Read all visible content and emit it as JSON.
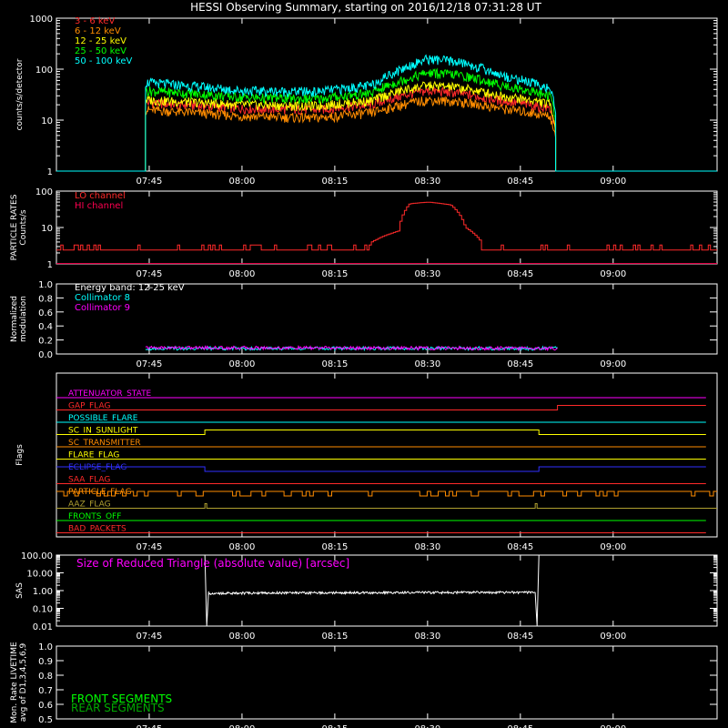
{
  "title": "HESSI Observing Summary, starting on 2016/12/18 07:31:28 UT",
  "time_ticks": [
    "07:45",
    "08:00",
    "08:15",
    "08:30",
    "08:45",
    "09:00"
  ],
  "colors": {
    "axes": "#ffffff",
    "red": "#ff2a2a",
    "orange": "#ff8c00",
    "yellow": "#ffff00",
    "green": "#00ff00",
    "cyan": "#00ffff",
    "magenta": "#ff00ff",
    "blue": "#3030ff",
    "olive": "#b0a030"
  },
  "chart_data": [
    {
      "id": "counts",
      "type": "line",
      "ylabel": "counts/s/detector",
      "yscale": "log",
      "ylim": [
        1,
        1000
      ],
      "y_ticks": [
        "1",
        "10",
        "100",
        "1000"
      ],
      "x_unit": "UT",
      "series": [
        {
          "name": "3 - 6 keV",
          "color": "#ff2a2a",
          "points": [
            [
              7.5,
              1
            ],
            [
              7.73,
              1
            ],
            [
              7.74,
              22
            ],
            [
              8.0,
              17
            ],
            [
              8.2,
              16
            ],
            [
              8.35,
              20
            ],
            [
              8.43,
              30
            ],
            [
              8.5,
              38
            ],
            [
              8.58,
              34
            ],
            [
              8.7,
              24
            ],
            [
              8.83,
              17
            ],
            [
              8.85,
              1
            ],
            [
              9.25,
              1
            ]
          ]
        },
        {
          "name": "6 - 12 keV",
          "color": "#ff8c00",
          "points": [
            [
              7.5,
              1
            ],
            [
              7.73,
              1
            ],
            [
              7.74,
              16
            ],
            [
              8.0,
              12
            ],
            [
              8.2,
              11
            ],
            [
              8.35,
              14
            ],
            [
              8.43,
              20
            ],
            [
              8.5,
              25
            ],
            [
              8.58,
              23
            ],
            [
              8.7,
              17
            ],
            [
              8.83,
              12
            ],
            [
              8.85,
              1
            ],
            [
              9.25,
              1
            ]
          ]
        },
        {
          "name": "12 - 25 keV",
          "color": "#ffff00",
          "points": [
            [
              7.5,
              1
            ],
            [
              7.73,
              1
            ],
            [
              7.74,
              25
            ],
            [
              8.0,
              20
            ],
            [
              8.2,
              19
            ],
            [
              8.35,
              24
            ],
            [
              8.43,
              38
            ],
            [
              8.5,
              48
            ],
            [
              8.58,
              44
            ],
            [
              8.7,
              30
            ],
            [
              8.83,
              21
            ],
            [
              8.85,
              1
            ],
            [
              9.25,
              1
            ]
          ]
        },
        {
          "name": "25 - 50 keV",
          "color": "#00ff00",
          "points": [
            [
              7.5,
              1
            ],
            [
              7.73,
              1
            ],
            [
              7.74,
              38
            ],
            [
              8.0,
              28
            ],
            [
              8.2,
              26
            ],
            [
              8.35,
              34
            ],
            [
              8.43,
              60
            ],
            [
              8.5,
              85
            ],
            [
              8.58,
              78
            ],
            [
              8.7,
              48
            ],
            [
              8.83,
              30
            ],
            [
              8.85,
              1
            ],
            [
              9.25,
              1
            ]
          ]
        },
        {
          "name": "50 - 100 keV",
          "color": "#00ffff",
          "points": [
            [
              7.5,
              1
            ],
            [
              7.73,
              1
            ],
            [
              7.74,
              55
            ],
            [
              8.0,
              38
            ],
            [
              8.2,
              36
            ],
            [
              8.35,
              48
            ],
            [
              8.43,
              100
            ],
            [
              8.5,
              160
            ],
            [
              8.58,
              140
            ],
            [
              8.7,
              75
            ],
            [
              8.83,
              42
            ],
            [
              8.85,
              1
            ],
            [
              9.25,
              1
            ]
          ]
        }
      ]
    },
    {
      "id": "particle",
      "type": "line",
      "ylabel": "PARTICLE RATES Counts/s",
      "yscale": "log",
      "ylim": [
        1,
        100
      ],
      "y_ticks": [
        "1",
        "10",
        "100"
      ],
      "series": [
        {
          "name": "LO channel",
          "color": "#ff2a2a",
          "points": [
            [
              7.5,
              2.5
            ],
            [
              7.9,
              2.5
            ],
            [
              8.1,
              2.8
            ],
            [
              8.33,
              3
            ],
            [
              8.42,
              8
            ],
            [
              8.45,
              45
            ],
            [
              8.5,
              50
            ],
            [
              8.56,
              42
            ],
            [
              8.6,
              10
            ],
            [
              8.65,
              3
            ],
            [
              8.85,
              2.5
            ],
            [
              9.25,
              2.5
            ]
          ]
        },
        {
          "name": "HI channel",
          "color": "#ff0050",
          "points": [
            [
              7.5,
              1
            ],
            [
              9.25,
              1
            ]
          ]
        }
      ]
    },
    {
      "id": "modulation",
      "type": "line",
      "ylabel": "Normalized modulation",
      "ylim": [
        0,
        1
      ],
      "y_ticks": [
        "0.0",
        "0.2",
        "0.4",
        "0.6",
        "0.8",
        "1.0"
      ],
      "annotation": "Energy band: 12-25 keV",
      "series": [
        {
          "name": "Collimator 8",
          "color": "#00ffff",
          "points": [
            [
              7.74,
              0.08
            ],
            [
              8.85,
              0.08
            ]
          ]
        },
        {
          "name": "Collimator 9",
          "color": "#ff00ff",
          "points": [
            [
              7.74,
              0.09
            ],
            [
              8.85,
              0.08
            ]
          ]
        }
      ]
    },
    {
      "id": "flags",
      "type": "line",
      "ylabel": "Flags",
      "flags": [
        {
          "name": "ATTENUATOR_STATE",
          "color": "#ff00ff",
          "segments": [
            [
              7.5,
              0
            ],
            [
              9.25,
              0
            ]
          ]
        },
        {
          "name": "GAP_FLAG",
          "color": "#ff2a2a",
          "segments": [
            [
              7.5,
              0
            ],
            [
              8.85,
              0
            ],
            [
              8.85,
              1
            ],
            [
              9.25,
              1
            ]
          ]
        },
        {
          "name": "POSSIBLE_FLARE",
          "color": "#00ffff",
          "segments": [
            [
              7.5,
              0
            ],
            [
              9.25,
              0
            ]
          ]
        },
        {
          "name": "SC_IN_SUNLIGHT",
          "color": "#ffff00",
          "segments": [
            [
              7.5,
              0
            ],
            [
              7.9,
              0
            ],
            [
              7.9,
              1
            ],
            [
              8.8,
              1
            ],
            [
              8.8,
              0
            ],
            [
              9.25,
              0
            ]
          ]
        },
        {
          "name": "SC_TRANSMITTER",
          "color": "#ff8c00",
          "segments": [
            [
              7.5,
              0
            ],
            [
              9.25,
              0
            ]
          ]
        },
        {
          "name": "FLARE_FLAG",
          "color": "#ffff00",
          "segments": [
            [
              7.5,
              0
            ],
            [
              9.25,
              0
            ]
          ]
        },
        {
          "name": "ECLIPSE_FLAG",
          "color": "#3030ff",
          "segments": [
            [
              7.5,
              1
            ],
            [
              7.9,
              1
            ],
            [
              7.9,
              0
            ],
            [
              8.8,
              0
            ],
            [
              8.8,
              1
            ],
            [
              9.25,
              1
            ]
          ]
        },
        {
          "name": "SAA_FLAG",
          "color": "#ff2a2a",
          "segments": [
            [
              7.5,
              0
            ],
            [
              9.25,
              0
            ]
          ]
        },
        {
          "name": "PARTICLE_FLAG",
          "color": "#ff8c00",
          "segments": [
            [
              7.5,
              1
            ],
            [
              9.25,
              1
            ]
          ]
        },
        {
          "name": "AAZ_FLAG",
          "color": "#b0a030",
          "segments": [
            [
              7.5,
              0
            ],
            [
              9.25,
              0
            ]
          ]
        },
        {
          "name": "FRONTS_OFF",
          "color": "#00ff00",
          "segments": [
            [
              7.5,
              0
            ],
            [
              9.25,
              0
            ]
          ]
        },
        {
          "name": "BAD_PACKETS",
          "color": "#ff2a2a",
          "segments": [
            [
              7.5,
              0
            ],
            [
              9.25,
              0
            ]
          ]
        }
      ]
    },
    {
      "id": "sas",
      "type": "line",
      "ylabel": "SAS",
      "yscale": "log",
      "ylim": [
        0.01,
        100
      ],
      "y_ticks": [
        "0.01",
        "0.10",
        "1.00",
        "10.00",
        "100.00"
      ],
      "annotation": "Size of Reduced Triangle (absolute value) [arcsec]",
      "series": [
        {
          "name": "SAS",
          "color": "#ffffff",
          "points": [
            [
              7.9,
              100
            ],
            [
              7.905,
              0.7
            ],
            [
              8.1,
              0.75
            ],
            [
              8.5,
              0.78
            ],
            [
              8.795,
              0.8
            ],
            [
              8.8,
              100
            ]
          ]
        }
      ]
    },
    {
      "id": "livetime",
      "type": "line",
      "ylabel": "Mon. Rate LIVETIME avg of D1,3,4,5,6,9",
      "ylim": [
        0.5,
        1.0
      ],
      "y_ticks": [
        "0.5",
        "0.6",
        "0.7",
        "0.8",
        "0.9",
        "1.0"
      ],
      "series": [
        {
          "name": "FRONT SEGMENTS",
          "color": "#00ff00",
          "points": []
        },
        {
          "name": "REAR SEGMENTS",
          "color": "#00aa00",
          "points": []
        }
      ]
    }
  ]
}
